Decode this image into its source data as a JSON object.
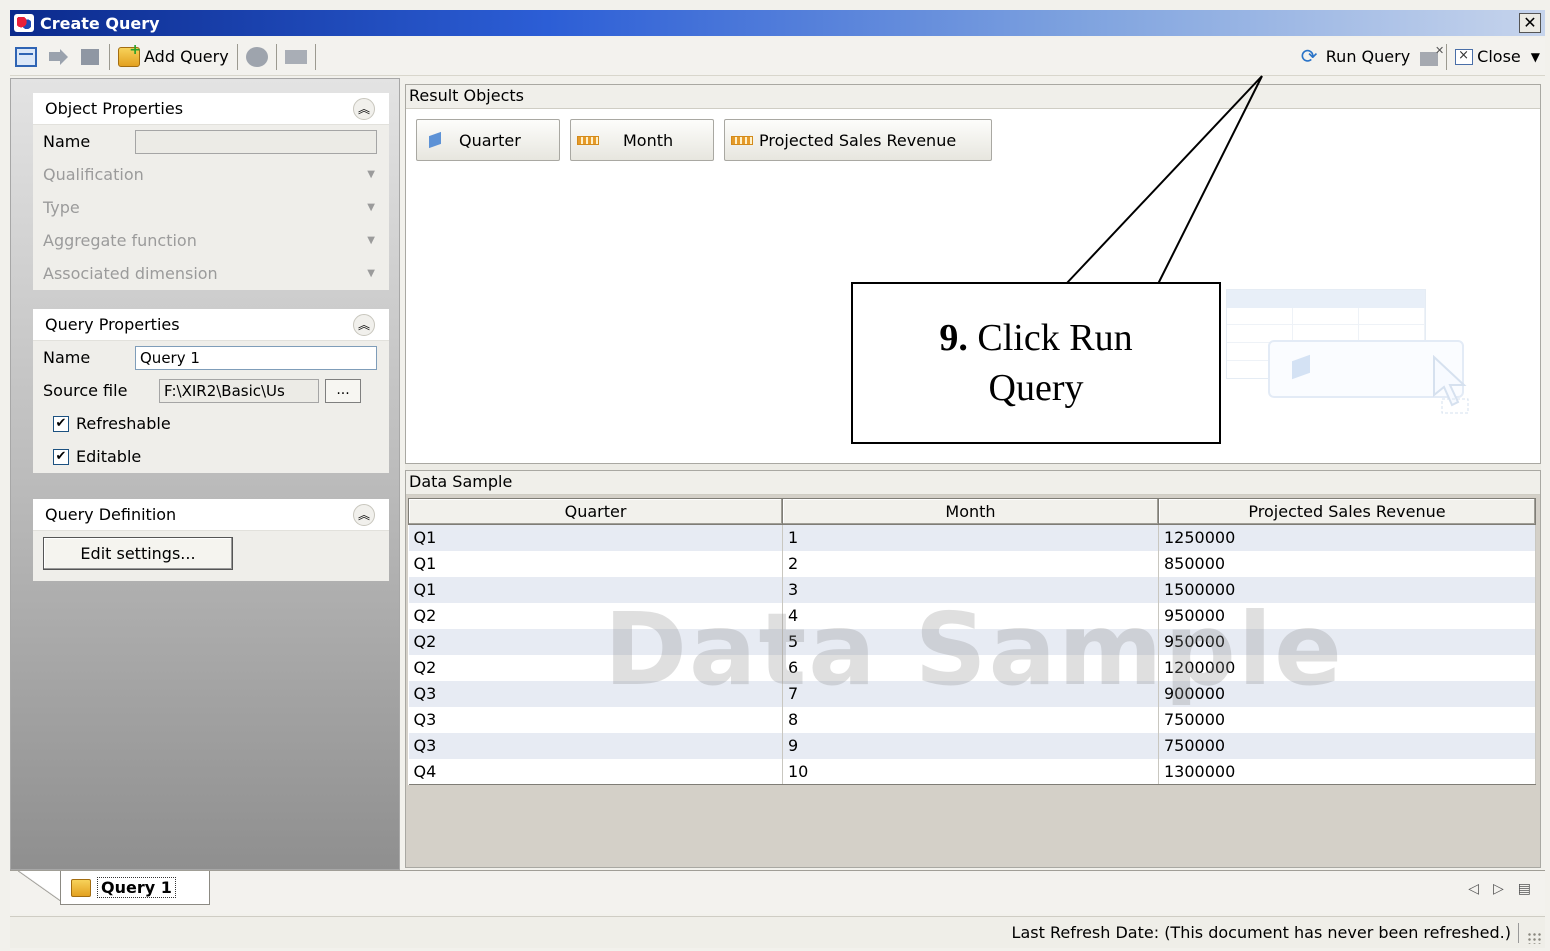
{
  "window": {
    "title": "Create Query",
    "close_glyph": "✕"
  },
  "toolbar": {
    "add_query_label": "Add Query",
    "run_query_label": "Run Query",
    "close_label": "Close",
    "icons": [
      "layout-icon",
      "move-arrow-icon",
      "grid-icon",
      "add-query-icon",
      "combine-icon",
      "sql-icon",
      "refresh-icon",
      "delete-icon",
      "close-doc-icon",
      "chevron-down-icon"
    ]
  },
  "object_properties": {
    "title": "Object Properties",
    "name_label": "Name",
    "name_value": "",
    "rows": [
      "Qualification",
      "Type",
      "Aggregate function",
      "Associated dimension"
    ]
  },
  "query_properties": {
    "title": "Query Properties",
    "name_label": "Name",
    "name_value": "Query 1",
    "source_label": "Source file",
    "source_value": "F:\\XIR2\\Basic\\Us",
    "ellipsis": "...",
    "refreshable_label": "Refreshable",
    "refreshable_checked": true,
    "editable_label": "Editable",
    "editable_checked": true
  },
  "query_definition": {
    "title": "Query Definition",
    "edit_label": "Edit settings..."
  },
  "result_objects": {
    "title": "Result Objects",
    "items": [
      {
        "label": "Quarter",
        "kind": "dimension"
      },
      {
        "label": "Month",
        "kind": "measure"
      },
      {
        "label": "Projected Sales Revenue",
        "kind": "measure"
      }
    ]
  },
  "data_sample": {
    "title": "Data Sample",
    "watermark": "Data Sample",
    "columns": [
      "Quarter",
      "Month",
      "Projected Sales Revenue"
    ],
    "rows": [
      [
        "Q1",
        "1",
        "1250000"
      ],
      [
        "Q1",
        "2",
        "850000"
      ],
      [
        "Q1",
        "3",
        "1500000"
      ],
      [
        "Q2",
        "4",
        "950000"
      ],
      [
        "Q2",
        "5",
        "950000"
      ],
      [
        "Q2",
        "6",
        "1200000"
      ],
      [
        "Q3",
        "7",
        "900000"
      ],
      [
        "Q3",
        "8",
        "750000"
      ],
      [
        "Q3",
        "9",
        "750000"
      ],
      [
        "Q4",
        "10",
        "1300000"
      ]
    ]
  },
  "tabs": {
    "active_label": "Query 1"
  },
  "status": {
    "text": "Last Refresh Date: (This document has never been refreshed.)"
  },
  "callout": {
    "step": "9.",
    "text_line1": "Click Run",
    "text_line2": "Query"
  }
}
